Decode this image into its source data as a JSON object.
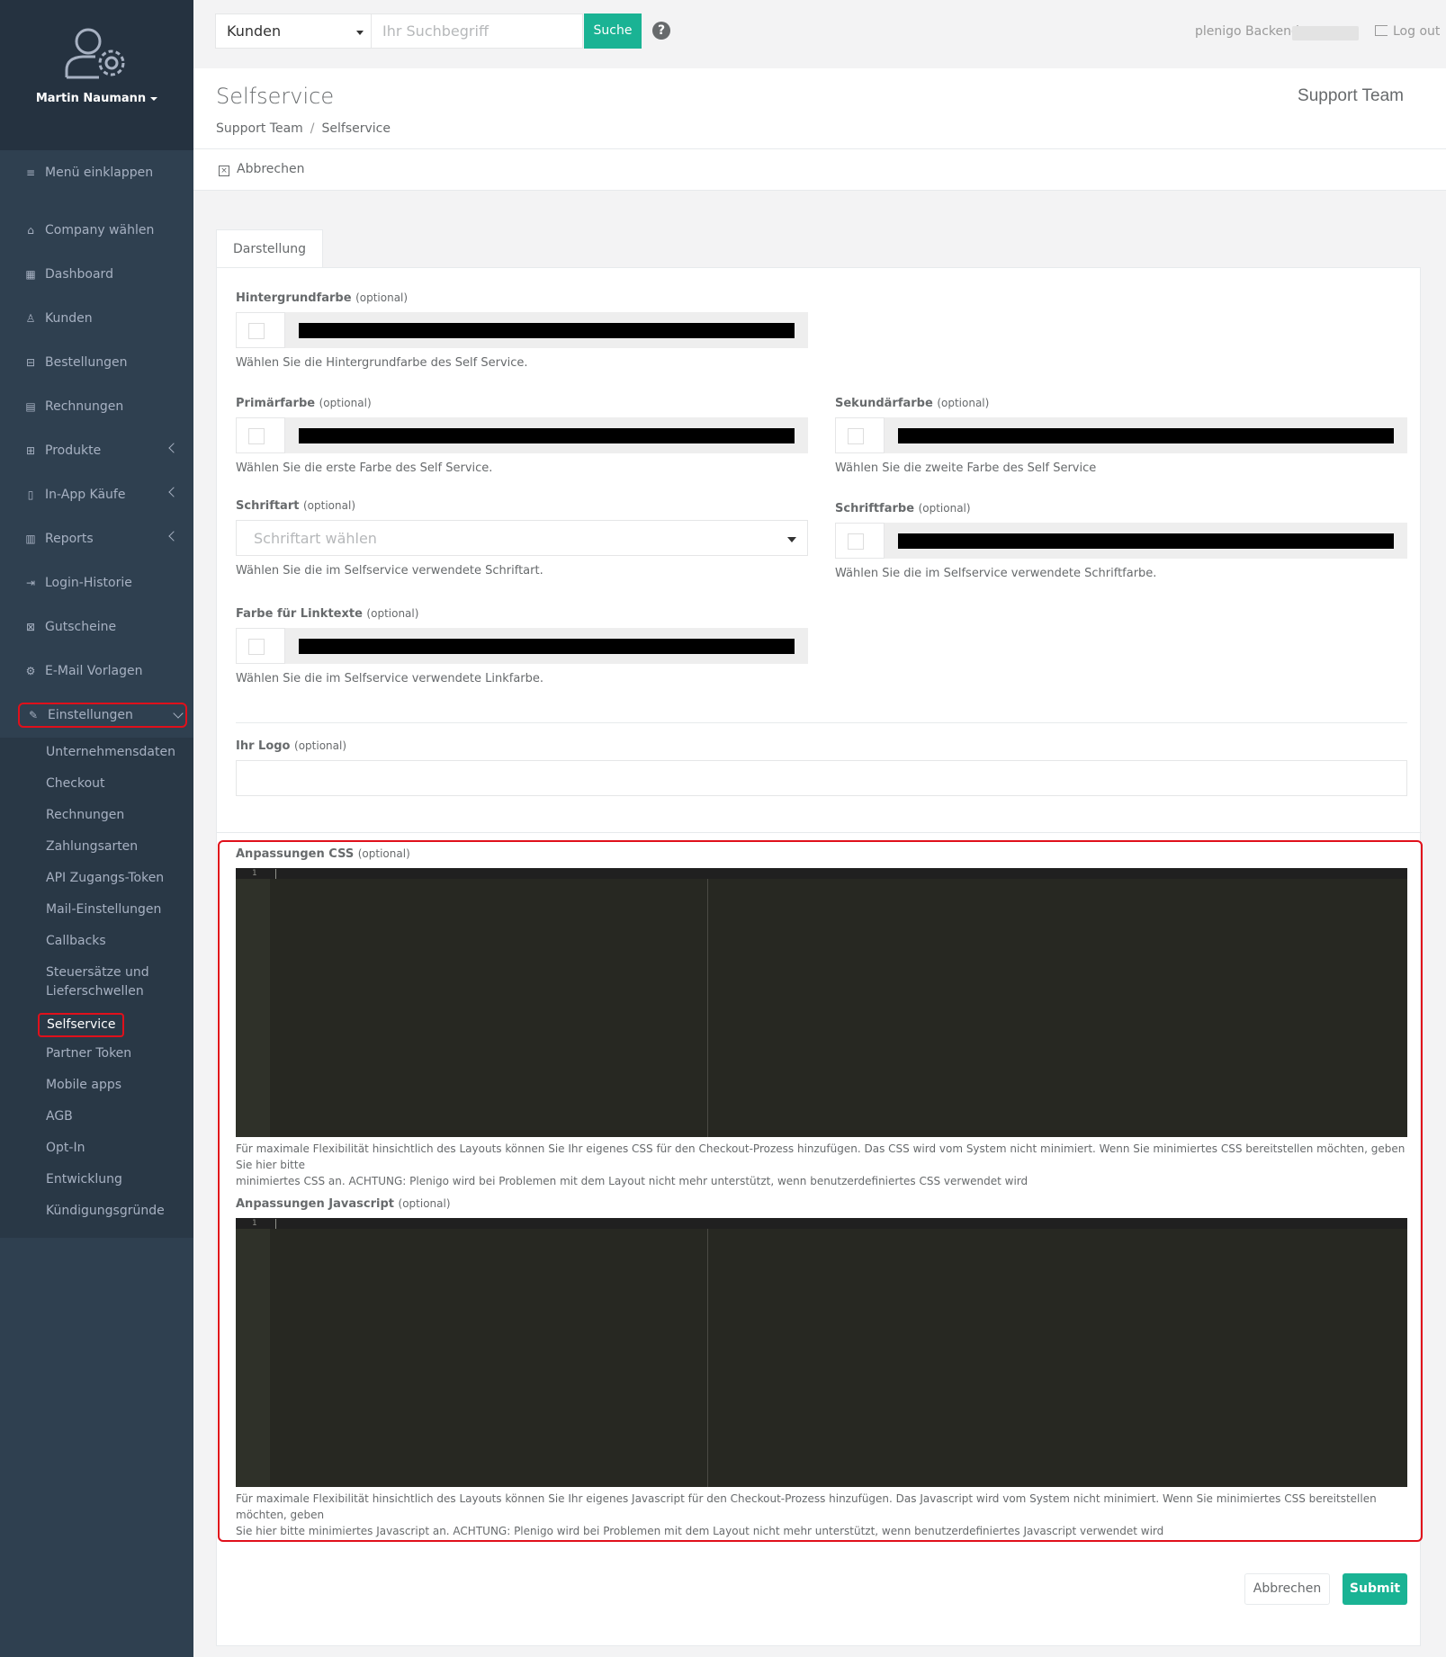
{
  "profile": {
    "name": "Martin Naumann"
  },
  "sidebar": {
    "collapse_label": "Menü einklappen",
    "items": [
      {
        "label": "Company wählen",
        "icon": "home-icon"
      },
      {
        "label": "Dashboard",
        "icon": "grid-icon"
      },
      {
        "label": "Kunden",
        "icon": "user-icon"
      },
      {
        "label": "Bestellungen",
        "icon": "basket-icon"
      },
      {
        "label": "Rechnungen",
        "icon": "file-icon"
      },
      {
        "label": "Produkte",
        "icon": "cube-icon"
      },
      {
        "label": "In-App Käufe",
        "icon": "mobile-icon"
      },
      {
        "label": "Reports",
        "icon": "bar-chart-icon"
      },
      {
        "label": "Login-Historie",
        "icon": "sign-in-icon"
      },
      {
        "label": "Gutscheine",
        "icon": "gift-icon"
      },
      {
        "label": "E-Mail Vorlagen",
        "icon": "cogs-icon"
      },
      {
        "label": "Einstellungen",
        "icon": "wrench-icon"
      }
    ],
    "submenu": [
      "Unternehmensdaten",
      "Checkout",
      "Rechnungen",
      "Zahlungsarten",
      "API Zugangs-Token",
      "Mail-Einstellungen",
      "Callbacks",
      "Steuersätze und",
      "Lieferschwellen",
      "Selfservice",
      "Partner Token",
      "Mobile apps",
      "AGB",
      "Opt-In",
      "Entwicklung",
      "Kündigungsgründe"
    ]
  },
  "topbar": {
    "search_scope": "Kunden",
    "search_placeholder": "Ihr Suchbegriff",
    "search_button": "Suche",
    "help": "?",
    "backend_label": "plenigo Backend",
    "logout": "Log out"
  },
  "header": {
    "title": "Selfservice",
    "breadcrumb": [
      "Support Team",
      "/",
      "Selfservice"
    ],
    "team": "Support Team"
  },
  "actions": {
    "cancel": "Abbrechen"
  },
  "tabs": [
    "Darstellung"
  ],
  "form": {
    "background": {
      "label": "Hintergrundfarbe",
      "optional": "(optional)",
      "help": "Wählen Sie die Hintergrundfarbe des Self Service."
    },
    "primary": {
      "label": "Primärfarbe",
      "optional": "(optional)",
      "help": "Wählen Sie die erste Farbe des Self Service."
    },
    "secondary": {
      "label": "Sekundärfarbe",
      "optional": "(optional)",
      "help": "Wählen Sie die zweite Farbe des Self Service"
    },
    "font": {
      "label": "Schriftart",
      "optional": "(optional)",
      "placeholder": "Schriftart wählen",
      "help": "Wählen Sie die im Selfservice verwendete Schriftart."
    },
    "font_color": {
      "label": "Schriftfarbe",
      "optional": "(optional)",
      "help": "Wählen Sie die im Selfservice verwendete Schriftfarbe."
    },
    "link_color": {
      "label": "Farbe für Linktexte",
      "optional": "(optional)",
      "help": "Wählen Sie die im Selfservice verwendete Linkfarbe."
    },
    "logo": {
      "label": "Ihr Logo",
      "optional": "(optional)"
    },
    "css": {
      "label": "Anpassungen CSS",
      "optional": "(optional)",
      "line": "1",
      "help_1": "Für maximale Flexibilität hinsichtlich des Layouts können Sie Ihr eigenes CSS für den Checkout-Prozess hinzufügen. Das CSS wird vom System nicht minimiert. Wenn Sie minimiertes CSS bereitstellen möchten, geben Sie hier bitte",
      "help_2": "minimiertes CSS an. ACHTUNG: Plenigo wird bei Problemen mit dem Layout nicht mehr unterstützt, wenn benutzerdefiniertes CSS verwendet wird"
    },
    "js": {
      "label": "Anpassungen Javascript",
      "optional": "(optional)",
      "line": "1",
      "help_1": "Für maximale Flexibilität hinsichtlich des Layouts können Sie Ihr eigenes Javascript für den Checkout-Prozess hinzufügen. Das Javascript wird vom System nicht minimiert. Wenn Sie minimiertes CSS bereitstellen möchten, geben",
      "help_2": "Sie hier bitte minimiertes Javascript an. ACHTUNG: Plenigo wird bei Problemen mit dem Layout nicht mehr unterstützt, wenn benutzerdefiniertes Javascript verwendet wird"
    },
    "cancel_button": "Abbrechen",
    "submit_button": "Submit"
  },
  "colors": {
    "sidebar": "#2f4050",
    "accent": "#1ab394",
    "highlight": "#e0101b",
    "editor": "#272822"
  }
}
